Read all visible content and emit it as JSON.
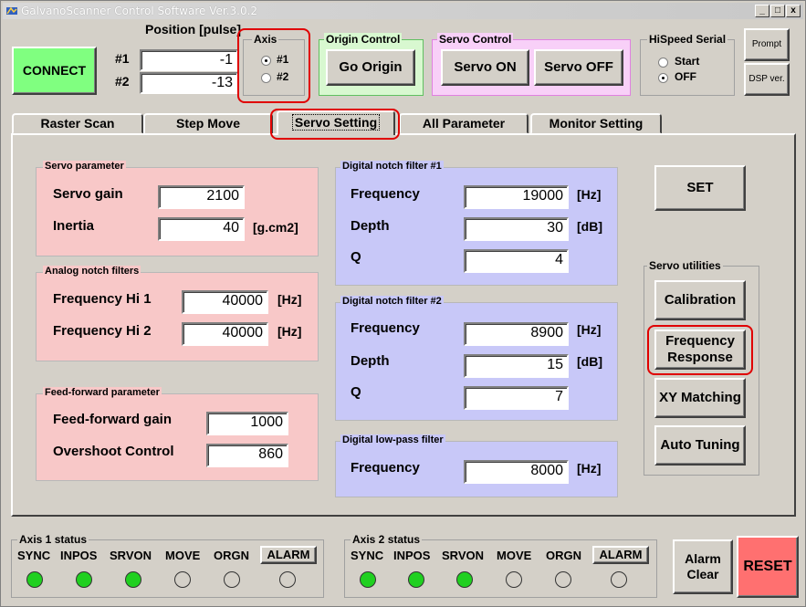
{
  "window": {
    "title": "GalvanoScanner Control Software Ver.3.0.2",
    "minimize": "_",
    "maximize": "□",
    "close": "x"
  },
  "toolbar": {
    "connect": "CONNECT",
    "position_title": "Position [pulse]",
    "pos1_label": "#1",
    "pos1_value": "-1",
    "pos2_label": "#2",
    "pos2_value": "-13",
    "axis_title": "Axis",
    "axis_opt1": "#1",
    "axis_opt2": "#2",
    "origin_title": "Origin Control",
    "go_origin": "Go Origin",
    "servo_title": "Servo Control",
    "servo_on": "Servo ON",
    "servo_off": "Servo OFF",
    "hispeed_title": "HiSpeed Serial",
    "hs_start": "Start",
    "hs_off": "OFF",
    "prompt": "Prompt",
    "dsp_ver": "DSP ver."
  },
  "tabs": [
    "Raster Scan",
    "Step Move",
    "Servo Setting",
    "All Parameter",
    "Monitor Setting"
  ],
  "servo_param": {
    "title": "Servo parameter",
    "gain_label": "Servo gain",
    "gain_value": "2100",
    "inertia_label": "Inertia",
    "inertia_value": "40",
    "inertia_unit": "[g.cm2]"
  },
  "analog_notch": {
    "title": "Analog notch filters",
    "hi1_label": "Frequency Hi 1",
    "hi1_value": "40000",
    "hi2_label": "Frequency Hi 2",
    "hi2_value": "40000",
    "unit": "[Hz]"
  },
  "feedforward": {
    "title": "Feed-forward parameter",
    "gain_label": "Feed-forward gain",
    "gain_value": "1000",
    "overshoot_label": "Overshoot Control",
    "overshoot_value": "860"
  },
  "notch1": {
    "title": "Digital notch filter #1",
    "freq_label": "Frequency",
    "freq_value": "19000",
    "freq_unit": "[Hz]",
    "depth_label": "Depth",
    "depth_value": "30",
    "depth_unit": "[dB]",
    "q_label": "Q",
    "q_value": "4"
  },
  "notch2": {
    "title": "Digital notch filter #2",
    "freq_label": "Frequency",
    "freq_value": "8900",
    "freq_unit": "[Hz]",
    "depth_label": "Depth",
    "depth_value": "15",
    "depth_unit": "[dB]",
    "q_label": "Q",
    "q_value": "7"
  },
  "lowpass": {
    "title": "Digital low-pass filter",
    "freq_label": "Frequency",
    "freq_value": "8000",
    "freq_unit": "[Hz]"
  },
  "actions": {
    "set": "SET",
    "utilities_title": "Servo utilities",
    "calibration": "Calibration",
    "freq_response": "Frequency Response",
    "xy_matching": "XY Matching",
    "auto_tuning": "Auto Tuning"
  },
  "axis1_status": {
    "title": "Axis 1 status",
    "labels": [
      "SYNC",
      "INPOS",
      "SRVON",
      "MOVE",
      "ORGN"
    ],
    "alarm": "ALARM",
    "states": [
      true,
      true,
      true,
      false,
      false,
      false
    ]
  },
  "axis2_status": {
    "title": "Axis 2 status",
    "labels": [
      "SYNC",
      "INPOS",
      "SRVON",
      "MOVE",
      "ORGN"
    ],
    "alarm": "ALARM",
    "states": [
      true,
      true,
      true,
      false,
      false,
      false
    ]
  },
  "footer": {
    "alarm_clear": "Alarm Clear",
    "reset": "RESET"
  },
  "colors": {
    "pink_panel": "#f8c8c8",
    "blue_panel": "#c8c8f8",
    "connect_green": "#80ff80",
    "origin_green": "#d8f8d0",
    "servo_pink": "#f8d0f8",
    "led_on": "#20d020",
    "reset_red": "#ff7070",
    "highlight": "#e00000"
  }
}
